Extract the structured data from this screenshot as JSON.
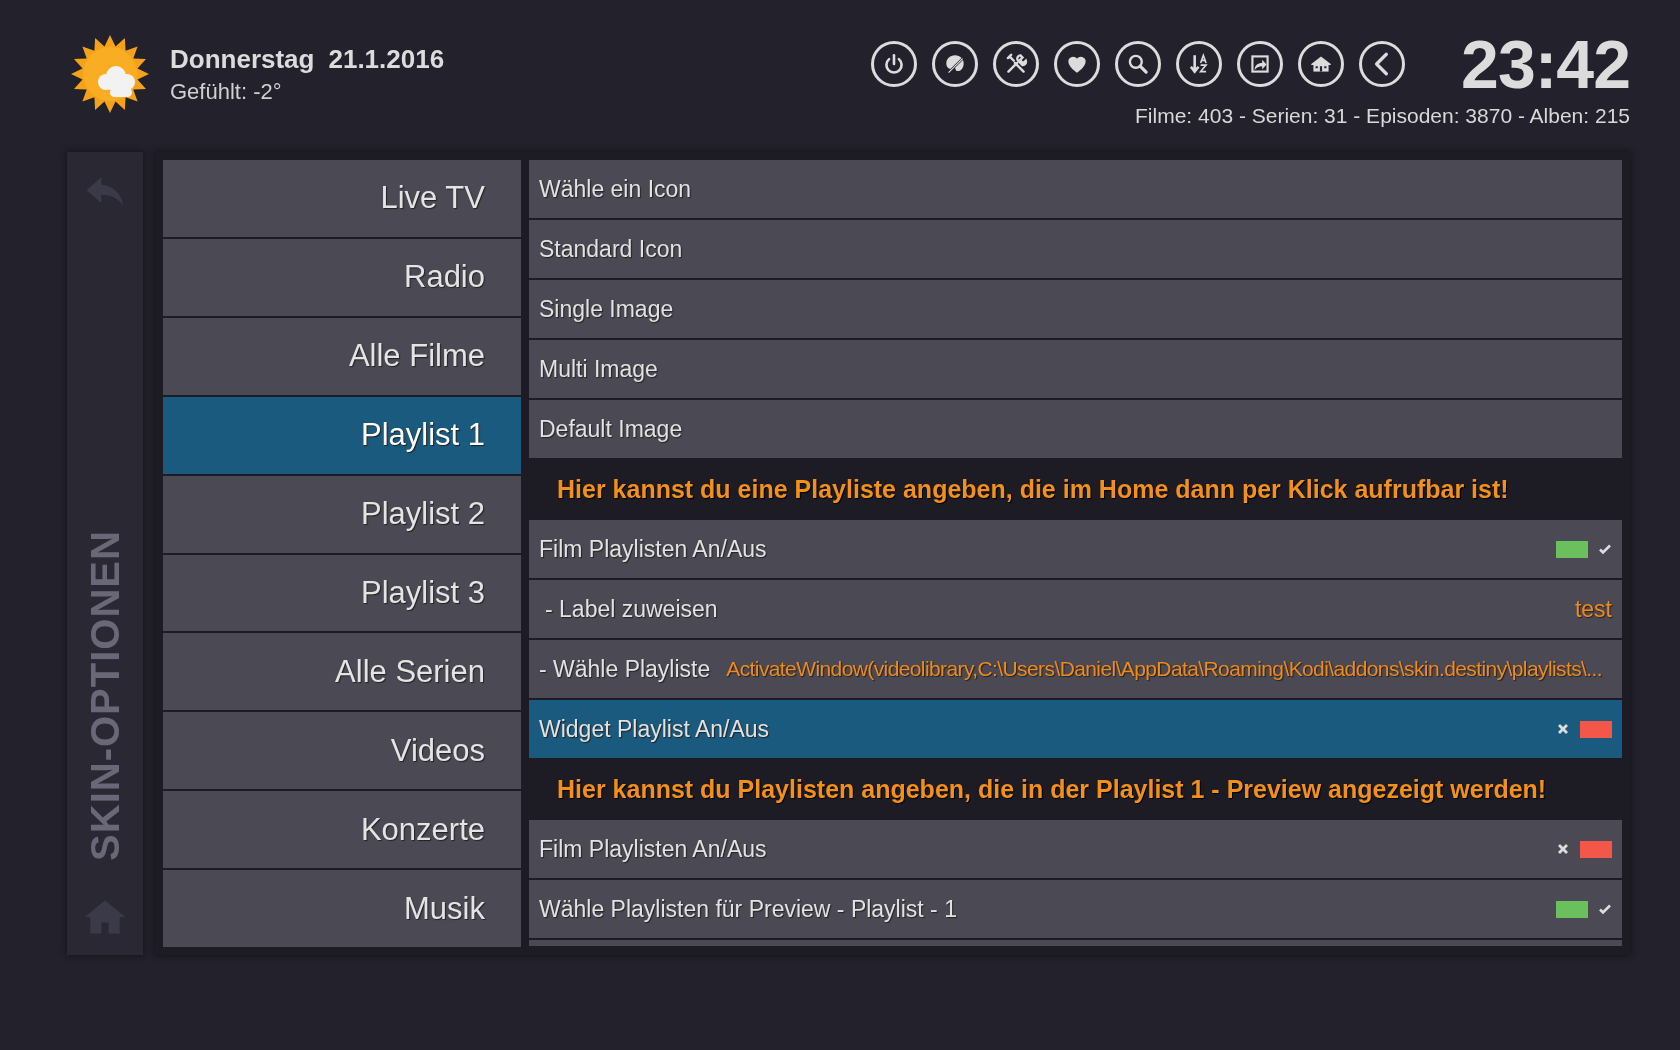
{
  "header": {
    "day": "Donnerstag",
    "date": "21.1.2016",
    "feels_like": "Gefühlt: -2°",
    "clock": "23:42",
    "stats": "Filme: 403 - Serien: 31 - Episoden: 3870 - Alben: 215"
  },
  "sidebar": {
    "title": "SKIN-OPTIONEN"
  },
  "menu": [
    {
      "label": "Live TV",
      "selected": false
    },
    {
      "label": "Radio",
      "selected": false
    },
    {
      "label": "Alle Filme",
      "selected": false
    },
    {
      "label": "Playlist 1",
      "selected": true
    },
    {
      "label": "Playlist 2",
      "selected": false
    },
    {
      "label": "Playlist 3",
      "selected": false
    },
    {
      "label": "Alle Serien",
      "selected": false
    },
    {
      "label": "Videos",
      "selected": false
    },
    {
      "label": "Konzerte",
      "selected": false
    },
    {
      "label": "Musik",
      "selected": false
    }
  ],
  "options": [
    {
      "kind": "item",
      "label": "Wähle ein Icon",
      "selected": false
    },
    {
      "kind": "item",
      "label": "Standard Icon",
      "selected": false
    },
    {
      "kind": "item",
      "label": "Single Image",
      "selected": false
    },
    {
      "kind": "item",
      "label": "Multi Image",
      "selected": false
    },
    {
      "kind": "item",
      "label": "Default Image",
      "selected": false
    },
    {
      "kind": "header",
      "label": "Hier kannst du eine Playliste angeben, die im Home dann per Klick aufrufbar ist!"
    },
    {
      "kind": "toggle",
      "label": "Film Playlisten An/Aus",
      "on": true,
      "selected": false
    },
    {
      "kind": "value",
      "label": "- Label zuweisen",
      "value": "test",
      "selected": false
    },
    {
      "kind": "path",
      "label": "- Wähle Playliste",
      "value": "ActivateWindow(videolibrary,C:\\Users\\Daniel\\AppData\\Roaming\\Kodi\\addons\\skin.destiny\\playlists\\...",
      "selected": false
    },
    {
      "kind": "toggle",
      "label": "Widget Playlist An/Aus",
      "on": false,
      "selected": true
    },
    {
      "kind": "header",
      "label": "Hier kannst du Playlisten angeben, die in der Playlist 1 - Preview angezeigt werden!"
    },
    {
      "kind": "toggle",
      "label": "Film Playlisten An/Aus",
      "on": false,
      "selected": false
    },
    {
      "kind": "toggle",
      "label": "Wähle Playlisten für Preview - Playlist - 1",
      "on": true,
      "selected": false
    }
  ]
}
